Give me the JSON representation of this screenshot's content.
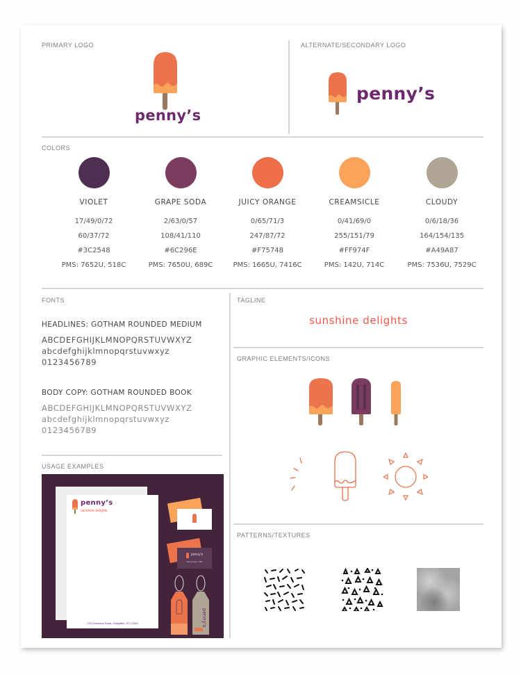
{
  "sections": {
    "primary_logo": "PRIMARY LOGO",
    "secondary_logo": "ALTERNATE/SECONDARY LOGO",
    "colors": "COLORS",
    "fonts": "FONTS",
    "tagline": "TAGLINE",
    "graphic_elements": "GRAPHIC ELEMENTS/ICONS",
    "usage_examples": "USAGE EXAMPLES",
    "patterns": "PATTERNS/TEXTURES"
  },
  "brand": {
    "wordmark": "penny’s",
    "tagline": "sunshine delights",
    "address": "123 Sunshine Road, Delightful, ST 12345",
    "card_name": "Penny Owner • CEO",
    "card_address": "123 Sunshine Road, Delightful, ST 12345"
  },
  "colors": [
    {
      "name": "VIOLET",
      "cmyk": "17/49/0/72",
      "rgb": "60/37/72",
      "hex": "#3C2548",
      "pms": "PMS: 7652U, 518C",
      "swatch": "#4e2f4f"
    },
    {
      "name": "GRAPE SODA",
      "cmyk": "2/63/0/57",
      "rgb": "108/41/110",
      "hex": "#6C296E",
      "pms": "PMS: 7650U, 689C",
      "swatch": "#7b3c5f"
    },
    {
      "name": "JUICY ORANGE",
      "cmyk": "0/65/71/3",
      "rgb": "247/87/72",
      "hex": "#F75748",
      "pms": "PMS: 1665U, 7416C",
      "swatch": "#ec6f4a"
    },
    {
      "name": "CREAMSICLE",
      "cmyk": "0/41/69/0",
      "rgb": "255/151/79",
      "hex": "#FF974F",
      "pms": "PMS: 142U, 714C",
      "swatch": "#f9a35b"
    },
    {
      "name": "CLOUDY",
      "cmyk": "0/6/18/36",
      "rgb": "164/154/135",
      "hex": "#A49A87",
      "pms": "PMS: 7536U, 7529C",
      "swatch": "#aea594"
    }
  ],
  "fonts": [
    {
      "heading": "HEADLINES: GOTHAM ROUNDED MEDIUM",
      "upper": "ABCDEFGHIJKLMNOPQRSTUVWXYZ",
      "lower": "abcdefghijklmnopqrstuvwxyz",
      "digits": "0123456789"
    },
    {
      "heading": "BODY COPY: GOTHAM ROUNDED BOOK",
      "upper": "ABCDEFGHIJKLMNOPQRSTUVWXYZ",
      "lower": "abcdefghijklmnopqrstuvwxyz",
      "digits": "0123456789"
    }
  ],
  "palette": {
    "violet": "#3C2548",
    "grape": "#6C296E",
    "orange": "#F75748",
    "creamsicle": "#FF974F",
    "cloudy": "#A49A87",
    "stick": "#9a7a5e"
  }
}
